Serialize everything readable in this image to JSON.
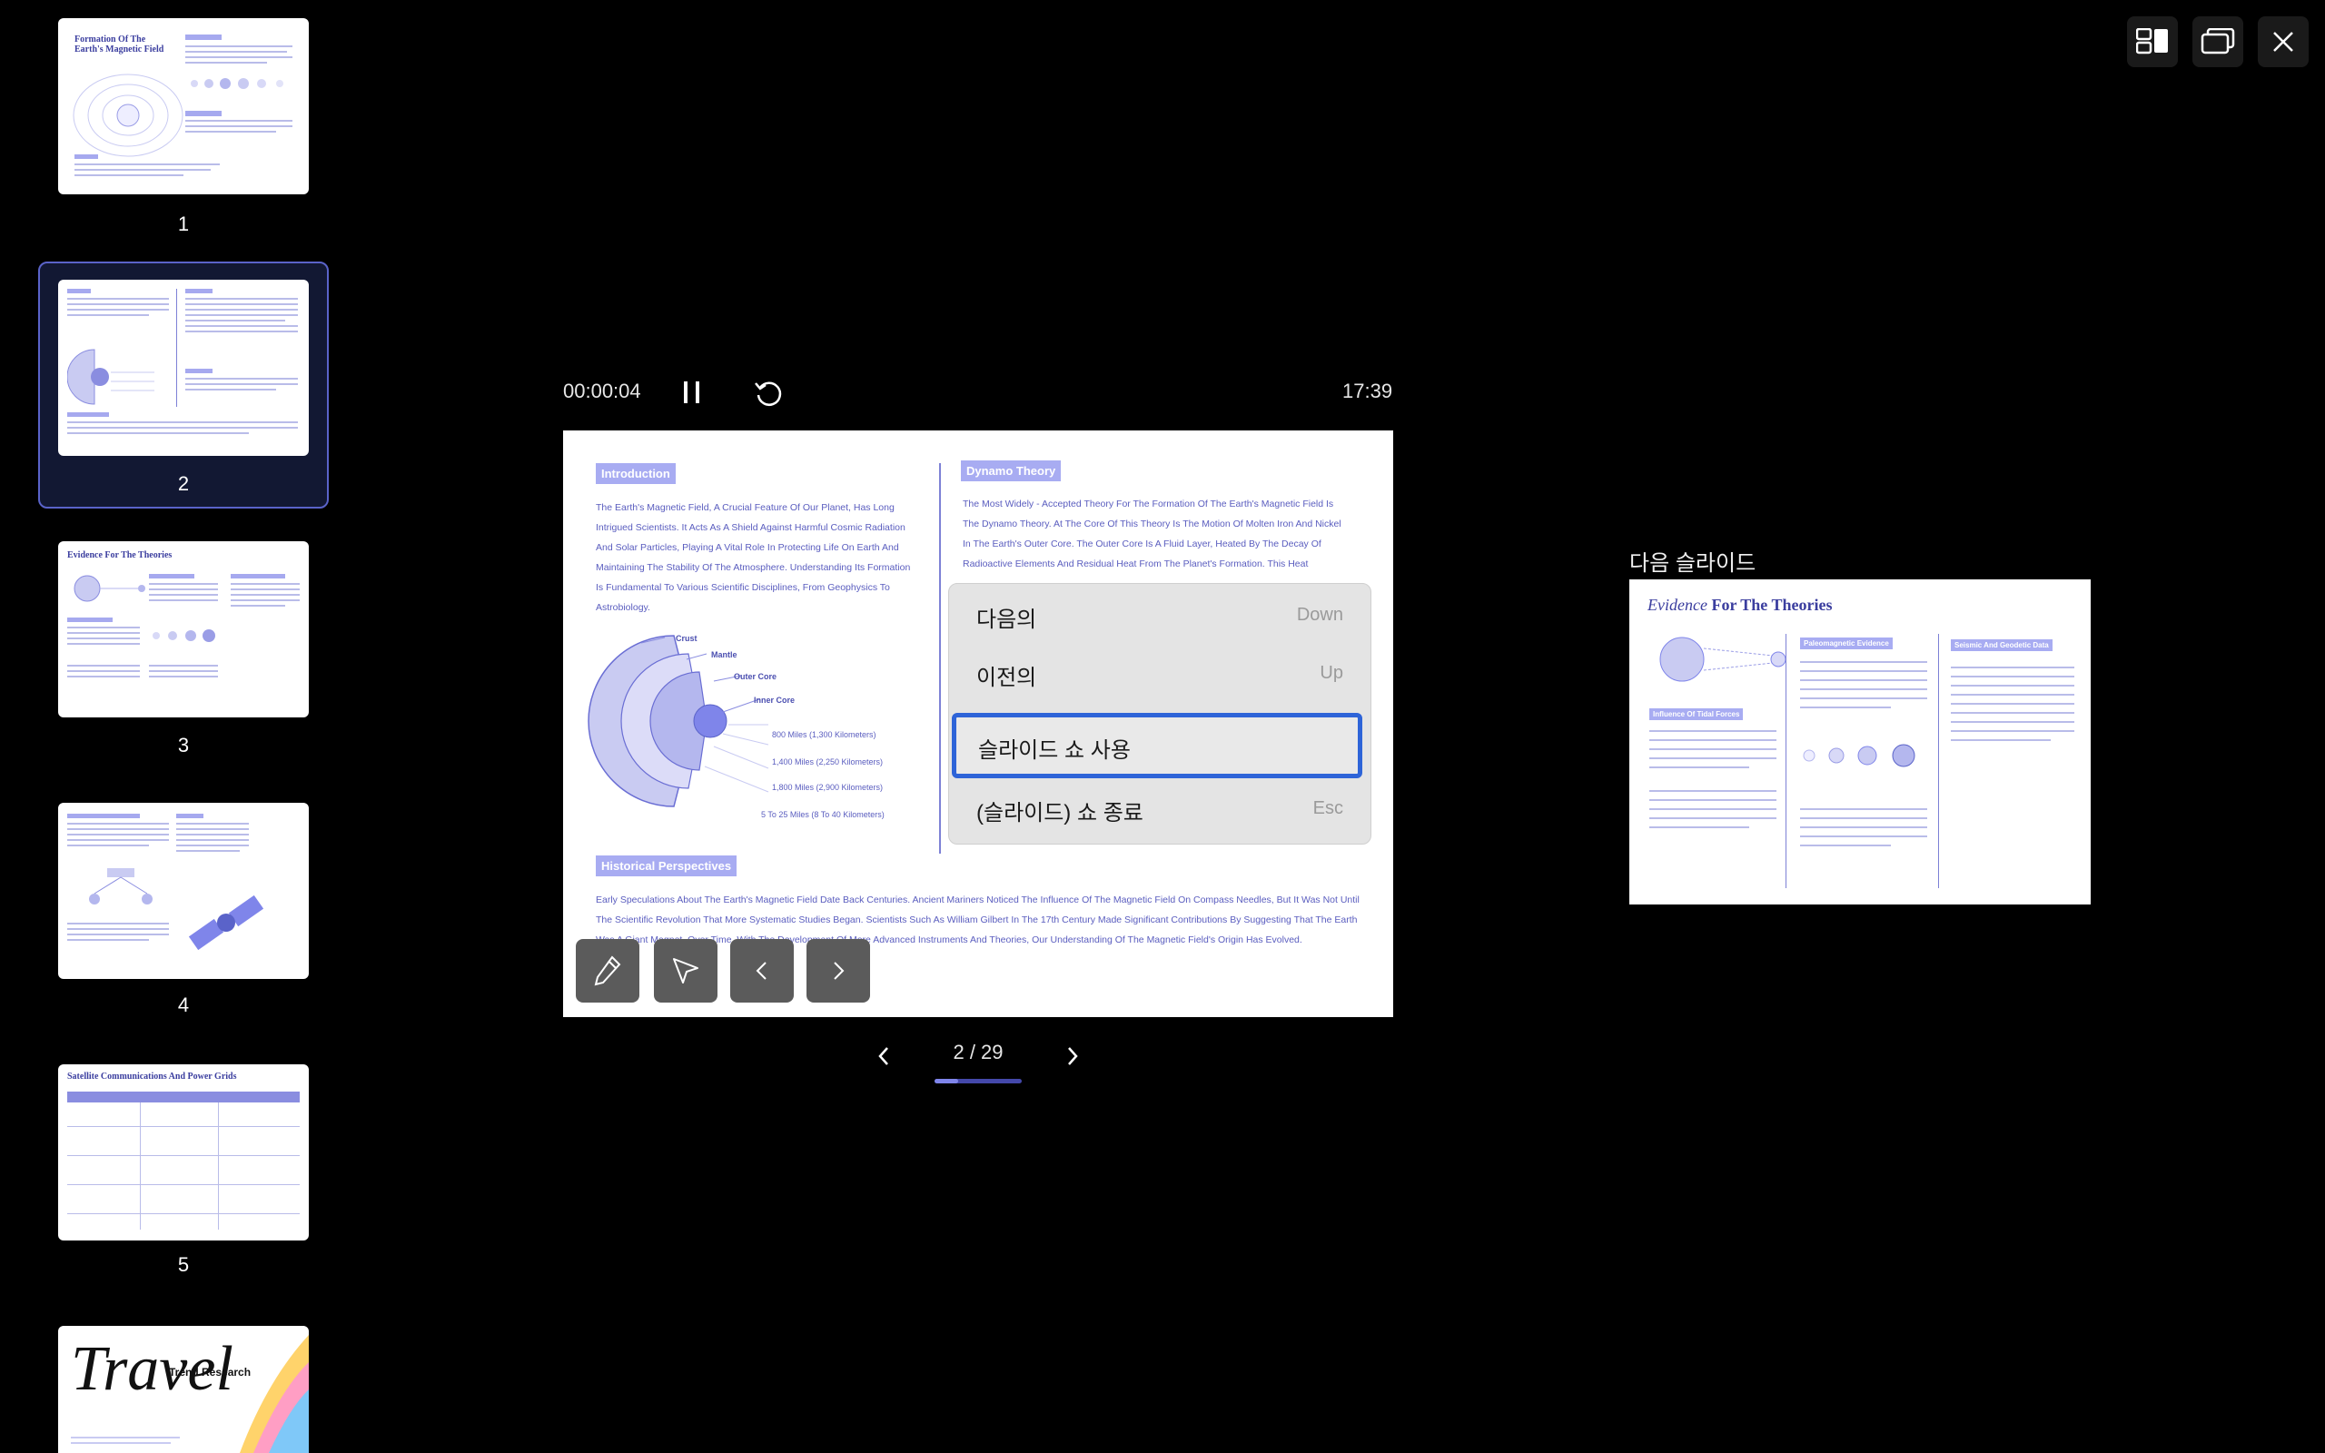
{
  "thumbnails": [
    {
      "num": "1",
      "title": "Formation Of The Earth's Magnetic Field"
    },
    {
      "num": "2",
      "title": ""
    },
    {
      "num": "3",
      "title": "Evidence For The Theories"
    },
    {
      "num": "4",
      "title": ""
    },
    {
      "num": "5",
      "title": "Satellite Communications And Power Grids"
    },
    {
      "num": "6",
      "title": "Travel",
      "subtitle": "Trend Research"
    }
  ],
  "presenter": {
    "elapsed": "00:00:04",
    "clock": "17:39",
    "page_indicator": "2 / 29",
    "progress_fraction": 0.069
  },
  "slide": {
    "intro_tag": "Introduction",
    "intro_text": "The Earth's Magnetic Field, A Crucial Feature Of Our Planet, Has Long Intrigued Scientists. It Acts As A Shield Against Harmful Cosmic Radiation And Solar Particles, Playing A Vital Role In Protecting Life On Earth And Maintaining The Stability Of The Atmosphere. Understanding Its Formation Is Fundamental To Various Scientific Disciplines, From Geophysics To Astrobiology.",
    "dynamo_tag": "Dynamo Theory",
    "dynamo_text": "The Most Widely - Accepted Theory For The Formation Of The Earth's Magnetic Field Is The Dynamo Theory. At The Core Of This Theory Is The Motion Of Molten Iron And Nickel In The Earth's Outer Core. The Outer Core Is A Fluid Layer, Heated By The Decay Of Radioactive Elements And Residual Heat From The Planet's Formation. This Heat Creates",
    "layers": [
      "Crust",
      "Mantle",
      "Outer Core",
      "Inner Core"
    ],
    "depths": [
      "800 Miles (1,300 Kilometers)",
      "1,400 Miles (2,250 Kilometers)",
      "1,800 Miles (2,900 Kilometers)",
      "5 To 25 Miles (8 To 40 Kilometers)"
    ],
    "hist_tag": "Historical Perspectives",
    "hist_text": "Early Speculations About The Earth's Magnetic Field Date Back Centuries. Ancient Mariners Noticed The Influence Of The Magnetic Field On Compass Needles, But It Was Not Until The Scientific Revolution That More Systematic Studies Began. Scientists Such As William Gilbert In The 17th Century Made Significant Contributions By Suggesting That The Earth Was A Giant Magnet. Over Time, With The Development Of More Advanced Instruments And Theories, Our Understanding Of The Magnetic Field's Origin Has Evolved."
  },
  "context_menu": [
    {
      "label": "다음의",
      "key": "Down"
    },
    {
      "label": "이전의",
      "key": "Up"
    },
    {
      "label": "슬라이드 쇼 사용",
      "key": ""
    },
    {
      "label": "(슬라이드) 쇼 종료",
      "key": "Esc"
    }
  ],
  "next_slide": {
    "label": "다음 슬라이드",
    "title_italic": "Evidence",
    "title_rest": " For The Theories",
    "tag_a": "Paleomagnetic Evidence",
    "tag_b": "Seismic And Geodetic Data",
    "tag_c": "Influence Of Tidal Forces"
  },
  "icons": {
    "layout": "layout-icon",
    "display": "display-switch-icon",
    "close": "close-icon",
    "pause": "pause-icon",
    "restart": "restart-icon",
    "pen": "pen-icon",
    "pointer": "pointer-icon",
    "prev": "chevron-left-icon",
    "next": "chevron-right-icon"
  },
  "colors": {
    "accent": "#5a63c9",
    "menu_highlight": "#2e64d8",
    "slide_tag": "#a8acf2",
    "slide_text": "#5a5dbf"
  }
}
